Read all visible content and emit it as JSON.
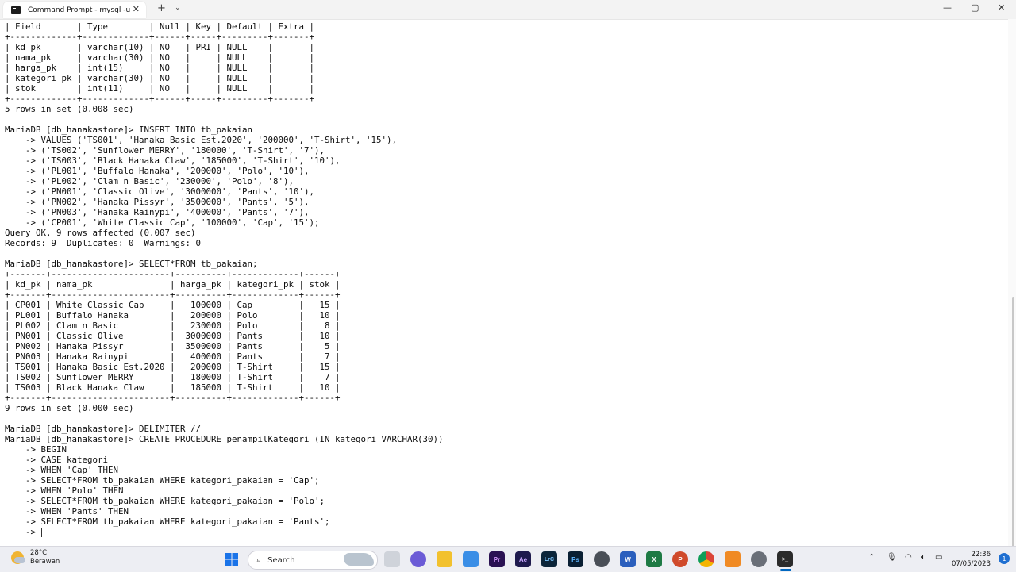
{
  "window": {
    "tab_title": "Command Prompt - mysql  -u",
    "tab_close": "✕",
    "new_tab": "+",
    "dropdown": "⌄",
    "minimize": "—",
    "maximize": "▢",
    "close": "✕"
  },
  "terminal": {
    "lines": [
      "| Field       | Type        | Null | Key | Default | Extra |",
      "+-------------+-------------+------+-----+---------+-------+",
      "| kd_pk       | varchar(10) | NO   | PRI | NULL    |       |",
      "| nama_pk     | varchar(30) | NO   |     | NULL    |       |",
      "| harga_pk    | int(15)     | NO   |     | NULL    |       |",
      "| kategori_pk | varchar(30) | NO   |     | NULL    |       |",
      "| stok        | int(11)     | NO   |     | NULL    |       |",
      "+-------------+-------------+------+-----+---------+-------+",
      "5 rows in set (0.008 sec)",
      "",
      "MariaDB [db_hanakastore]> INSERT INTO tb_pakaian",
      "    -> VALUES ('TS001', 'Hanaka Basic Est.2020', '200000', 'T-Shirt', '15'),",
      "    -> ('TS002', 'Sunflower MERRY', '180000', 'T-Shirt', '7'),",
      "    -> ('TS003', 'Black Hanaka Claw', '185000', 'T-Shirt', '10'),",
      "    -> ('PL001', 'Buffalo Hanaka', '200000', 'Polo', '10'),",
      "    -> ('PL002', 'Clam n Basic', '230000', 'Polo', '8'),",
      "    -> ('PN001', 'Classic Olive', '3000000', 'Pants', '10'),",
      "    -> ('PN002', 'Hanaka Pissyr', '3500000', 'Pants', '5'),",
      "    -> ('PN003', 'Hanaka Rainypi', '400000', 'Pants', '7'),",
      "    -> ('CP001', 'White Classic Cap', '100000', 'Cap', '15');",
      "Query OK, 9 rows affected (0.007 sec)",
      "Records: 9  Duplicates: 0  Warnings: 0",
      "",
      "MariaDB [db_hanakastore]> SELECT*FROM tb_pakaian;",
      "+-------+-----------------------+----------+-------------+------+",
      "| kd_pk | nama_pk               | harga_pk | kategori_pk | stok |",
      "+-------+-----------------------+----------+-------------+------+",
      "| CP001 | White Classic Cap     |   100000 | Cap         |   15 |",
      "| PL001 | Buffalo Hanaka        |   200000 | Polo        |   10 |",
      "| PL002 | Clam n Basic          |   230000 | Polo        |    8 |",
      "| PN001 | Classic Olive         |  3000000 | Pants       |   10 |",
      "| PN002 | Hanaka Pissyr         |  3500000 | Pants       |    5 |",
      "| PN003 | Hanaka Rainypi        |   400000 | Pants       |    7 |",
      "| TS001 | Hanaka Basic Est.2020 |   200000 | T-Shirt     |   15 |",
      "| TS002 | Sunflower MERRY       |   180000 | T-Shirt     |    7 |",
      "| TS003 | Black Hanaka Claw     |   185000 | T-Shirt     |   10 |",
      "+-------+-----------------------+----------+-------------+------+",
      "9 rows in set (0.000 sec)",
      "",
      "MariaDB [db_hanakastore]> DELIMITER //",
      "MariaDB [db_hanakastore]> CREATE PROCEDURE penampilKategori (IN kategori VARCHAR(30))",
      "    -> BEGIN",
      "    -> CASE kategori",
      "    -> WHEN 'Cap' THEN",
      "    -> SELECT*FROM tb_pakaian WHERE kategori_pakaian = 'Cap';",
      "    -> WHEN 'Polo' THEN",
      "    -> SELECT*FROM tb_pakaian WHERE kategori_pakaian = 'Polo';",
      "    -> WHEN 'Pants' THEN",
      "    -> SELECT*FROM tb_pakaian WHERE kategori_pakaian = 'Pants';"
    ],
    "prompt_line": "    -> "
  },
  "taskbar": {
    "temperature": "28°C",
    "condition": "Berawan",
    "search_label": "Search",
    "time": "22:36",
    "date": "07/05/2023",
    "apps": [
      {
        "name": "start-icon",
        "label": ""
      },
      {
        "name": "task-view-icon",
        "label": ""
      },
      {
        "name": "meet-icon",
        "label": ""
      },
      {
        "name": "file-explorer-icon",
        "label": ""
      },
      {
        "name": "store-icon",
        "label": ""
      },
      {
        "name": "premiere-icon",
        "label": "Pr"
      },
      {
        "name": "after-effects-icon",
        "label": "Ae"
      },
      {
        "name": "lightroom-icon",
        "label": "LrC"
      },
      {
        "name": "photoshop-icon",
        "label": "Ps"
      },
      {
        "name": "app-icon",
        "label": ""
      },
      {
        "name": "word-icon",
        "label": "W"
      },
      {
        "name": "excel-icon",
        "label": "X"
      },
      {
        "name": "powerpoint-icon",
        "label": "P"
      },
      {
        "name": "chrome-icon",
        "label": ""
      },
      {
        "name": "xampp-icon",
        "label": ""
      },
      {
        "name": "settings-icon",
        "label": ""
      },
      {
        "name": "terminal-icon",
        "label": ">_"
      }
    ],
    "notification_count": "1"
  },
  "colors": {
    "terminal_bg": "#ffffff",
    "terminal_text": "#0c0c0c",
    "taskbar_bg": "#edeef3",
    "accent": "#0067c0"
  }
}
